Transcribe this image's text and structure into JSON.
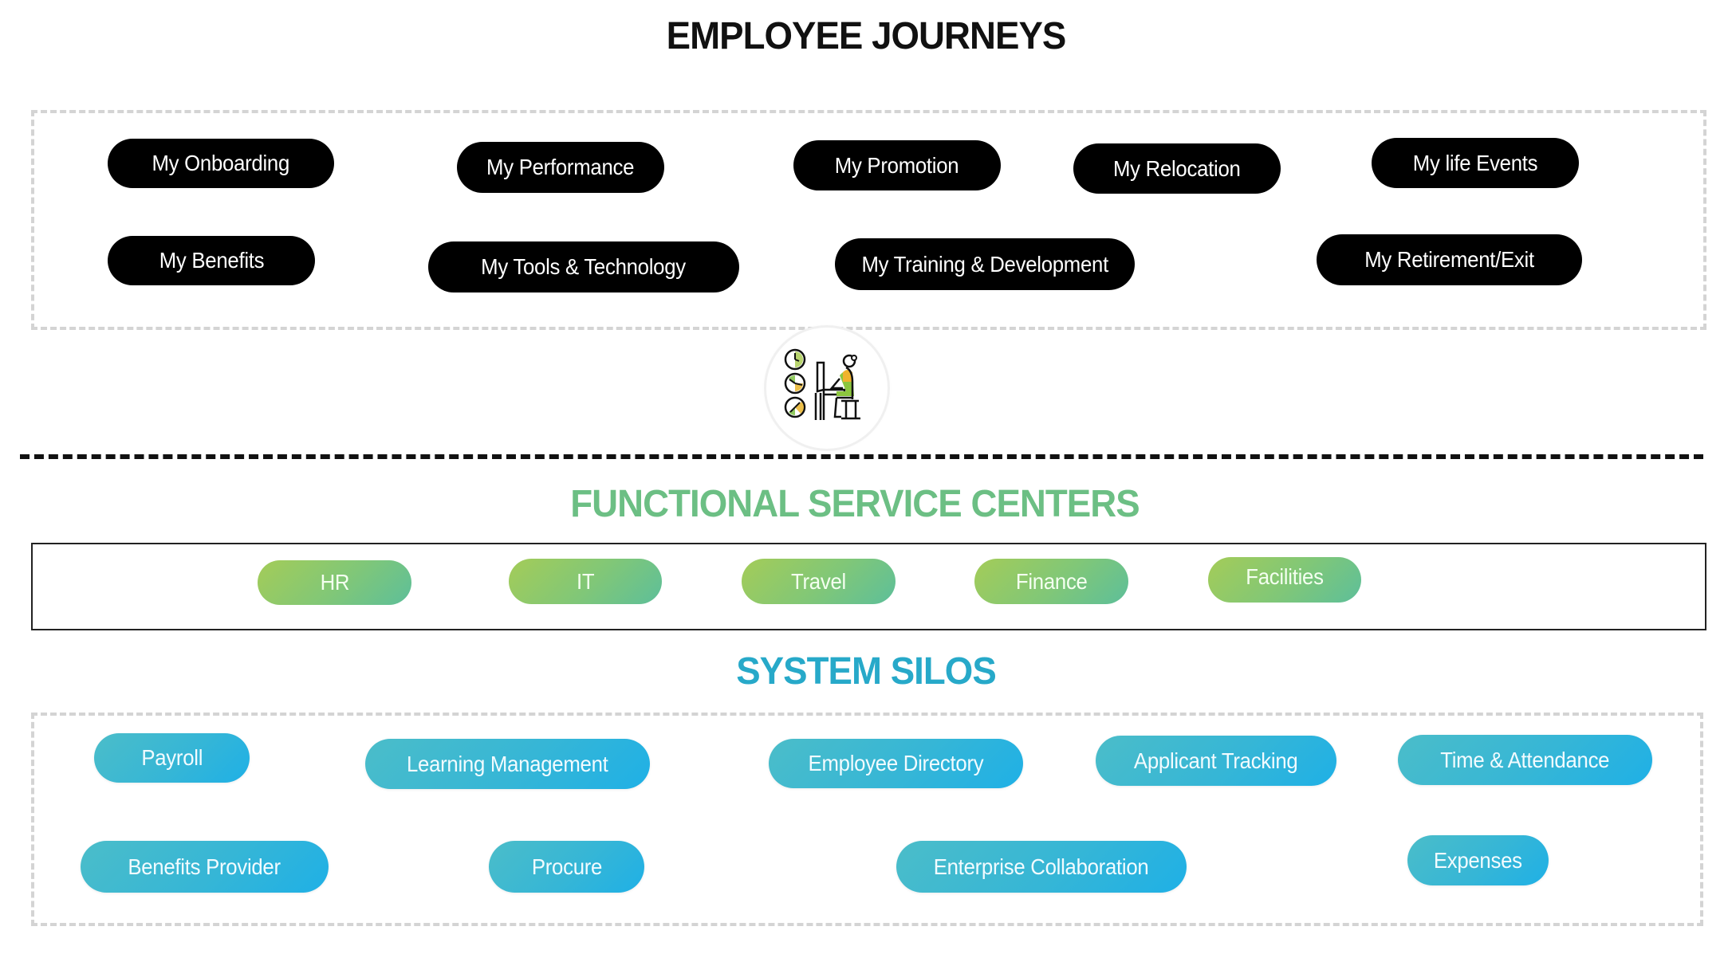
{
  "employee_journeys": {
    "title": "EMPLOYEE JOURNEYS",
    "title_color": "#111111",
    "items": [
      "My Onboarding",
      "My Performance",
      "My Promotion",
      "My Relocation",
      "My life Events",
      "My Benefits",
      "My Tools & Technology",
      "My Training & Development",
      "My Retirement/Exit"
    ]
  },
  "center_icon": "employee-at-workstation-with-clocks-icon",
  "functional_service_centers": {
    "title": "FUNCTIONAL SERVICE CENTERS",
    "title_color": "#6cbf84",
    "items": [
      "HR",
      "IT",
      "Travel",
      "Finance",
      "Facilities"
    ]
  },
  "system_silos": {
    "title": "SYSTEM SILOS",
    "title_color": "#27a9c9",
    "items": [
      "Payroll",
      "Learning Management",
      "Employee Directory",
      "Applicant Tracking",
      "Time & Attendance",
      "Benefits Provider",
      "Procure",
      "Enterprise Collaboration",
      "Expenses"
    ]
  }
}
